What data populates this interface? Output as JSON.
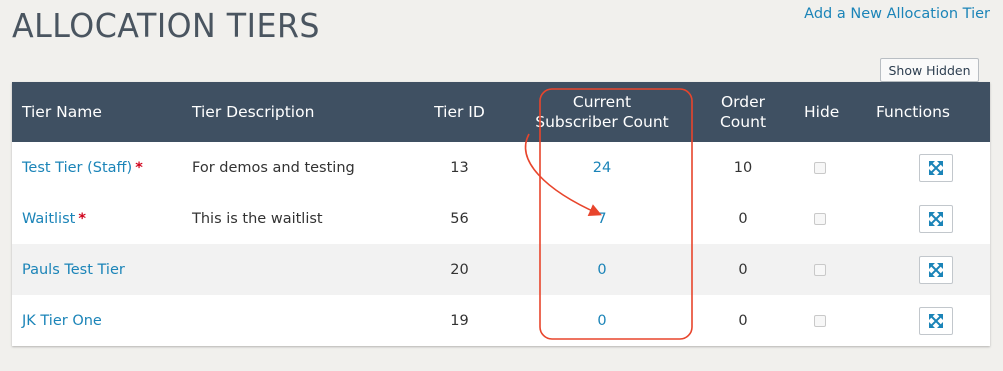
{
  "header": {
    "title": "ALLOCATION TIERS",
    "add_link": "Add a New Allocation Tier",
    "show_hidden_label": "Show Hidden"
  },
  "table": {
    "columns": {
      "name": "Tier Name",
      "description": "Tier Description",
      "id": "Tier ID",
      "subscribers_line1": "Current",
      "subscribers_line2": "Subscriber Count",
      "order_line1": "Order",
      "order_line2": "Count",
      "hide": "Hide",
      "functions": "Functions"
    },
    "rows": [
      {
        "name": "Test Tier (Staff)",
        "required": "*",
        "description": "For demos and testing",
        "id": "13",
        "subscribers": "24",
        "orders": "10"
      },
      {
        "name": "Waitlist",
        "required": "*",
        "description": "This is the waitlist",
        "id": "56",
        "subscribers": "7",
        "orders": "0"
      },
      {
        "name": "Pauls Test Tier",
        "required": "",
        "description": "",
        "id": "20",
        "subscribers": "0",
        "orders": "0"
      },
      {
        "name": "JK Tier One",
        "required": "",
        "description": "",
        "id": "19",
        "subscribers": "0",
        "orders": "0"
      }
    ]
  },
  "colors": {
    "header_bg": "#3f5062",
    "link": "#1b84b8",
    "required": "#d0021b",
    "annotation": "#e8452c"
  },
  "icons": {
    "row_function": "expand-arrows-icon"
  }
}
